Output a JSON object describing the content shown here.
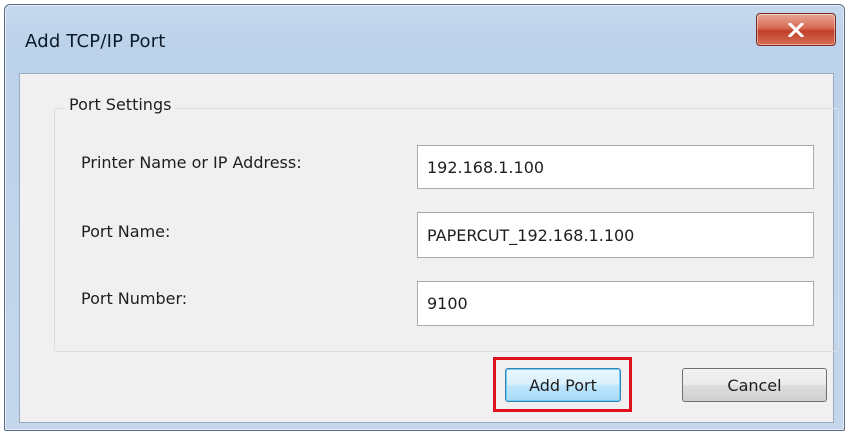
{
  "window": {
    "title": "Add TCP/IP Port",
    "close_icon": "close-icon"
  },
  "port_settings": {
    "legend": "Port Settings",
    "fields": [
      {
        "label": "Printer Name or IP Address:",
        "value": "192.168.1.100"
      },
      {
        "label": "Port Name:",
        "value": "PAPERCUT_192.168.1.100"
      },
      {
        "label": "Port Number:",
        "value": "9100"
      }
    ]
  },
  "buttons": {
    "add_port": "Add Port",
    "cancel": "Cancel"
  },
  "annotation": {
    "highlight_color": "#e0101e",
    "highlight_target": "add-port-button"
  }
}
